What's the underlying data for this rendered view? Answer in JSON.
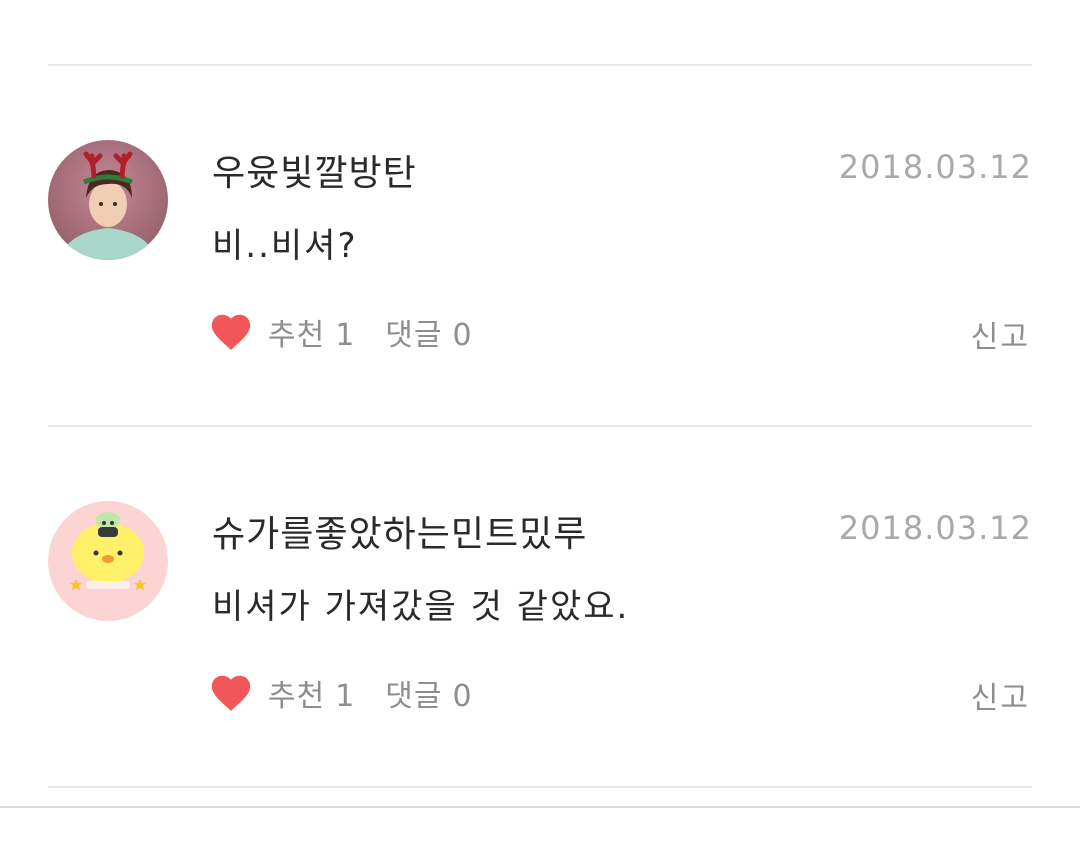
{
  "comments": [
    {
      "author": "우윳빛깔방탄",
      "date": "2018.03.12",
      "text": "비..비셔?",
      "recommend_label": "추천",
      "recommend_count": "1",
      "reply_label": "댓글",
      "reply_count": "0",
      "report_label": "신고",
      "avatar_icon": "profile-photo-reindeer-antlers"
    },
    {
      "author": "슈가를좋았하는민트밌루",
      "date": "2018.03.12",
      "text": "비셔가 가져갔을 것 같았요.",
      "recommend_label": "추천",
      "recommend_count": "1",
      "reply_label": "댓글",
      "reply_count": "0",
      "report_label": "신고",
      "avatar_icon": "chick-character-sticker"
    }
  ],
  "colors": {
    "heart": "#f0565a",
    "divider": "#e8e8e8",
    "text": "#2a2a2a",
    "muted": "#8e8e8e",
    "date": "#a9a9a9",
    "avatar2_bg": "#fbd5d3"
  }
}
